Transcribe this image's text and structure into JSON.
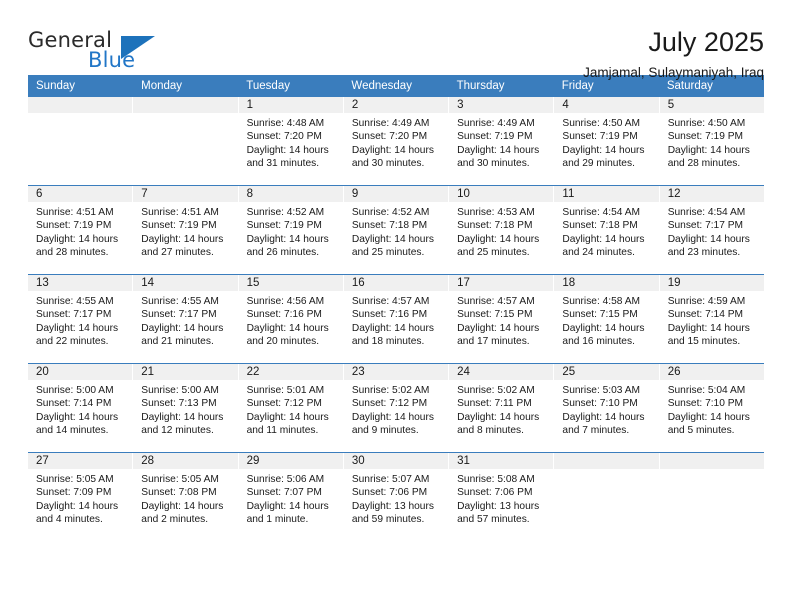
{
  "brand": {
    "name_part1": "General",
    "name_part2": "Blue",
    "triangle_icon": "brand-triangle-icon",
    "accent_color": "#1d72bb"
  },
  "header": {
    "title": "July 2025",
    "subtitle": "Jamjamal, Sulaymaniyah, Iraq"
  },
  "colors": {
    "header_blue": "#3a7dbd",
    "daynum_band": "#f0f0f0",
    "text": "#1a1a1a"
  },
  "calendar": {
    "day_headers": [
      "Sunday",
      "Monday",
      "Tuesday",
      "Wednesday",
      "Thursday",
      "Friday",
      "Saturday"
    ],
    "weeks": [
      [
        {
          "day": "",
          "sunrise": "",
          "sunset": "",
          "daylight_line1": "",
          "daylight_line2": ""
        },
        {
          "day": "",
          "sunrise": "",
          "sunset": "",
          "daylight_line1": "",
          "daylight_line2": ""
        },
        {
          "day": "1",
          "sunrise": "Sunrise: 4:48 AM",
          "sunset": "Sunset: 7:20 PM",
          "daylight_line1": "Daylight: 14 hours",
          "daylight_line2": "and 31 minutes."
        },
        {
          "day": "2",
          "sunrise": "Sunrise: 4:49 AM",
          "sunset": "Sunset: 7:20 PM",
          "daylight_line1": "Daylight: 14 hours",
          "daylight_line2": "and 30 minutes."
        },
        {
          "day": "3",
          "sunrise": "Sunrise: 4:49 AM",
          "sunset": "Sunset: 7:19 PM",
          "daylight_line1": "Daylight: 14 hours",
          "daylight_line2": "and 30 minutes."
        },
        {
          "day": "4",
          "sunrise": "Sunrise: 4:50 AM",
          "sunset": "Sunset: 7:19 PM",
          "daylight_line1": "Daylight: 14 hours",
          "daylight_line2": "and 29 minutes."
        },
        {
          "day": "5",
          "sunrise": "Sunrise: 4:50 AM",
          "sunset": "Sunset: 7:19 PM",
          "daylight_line1": "Daylight: 14 hours",
          "daylight_line2": "and 28 minutes."
        }
      ],
      [
        {
          "day": "6",
          "sunrise": "Sunrise: 4:51 AM",
          "sunset": "Sunset: 7:19 PM",
          "daylight_line1": "Daylight: 14 hours",
          "daylight_line2": "and 28 minutes."
        },
        {
          "day": "7",
          "sunrise": "Sunrise: 4:51 AM",
          "sunset": "Sunset: 7:19 PM",
          "daylight_line1": "Daylight: 14 hours",
          "daylight_line2": "and 27 minutes."
        },
        {
          "day": "8",
          "sunrise": "Sunrise: 4:52 AM",
          "sunset": "Sunset: 7:19 PM",
          "daylight_line1": "Daylight: 14 hours",
          "daylight_line2": "and 26 minutes."
        },
        {
          "day": "9",
          "sunrise": "Sunrise: 4:52 AM",
          "sunset": "Sunset: 7:18 PM",
          "daylight_line1": "Daylight: 14 hours",
          "daylight_line2": "and 25 minutes."
        },
        {
          "day": "10",
          "sunrise": "Sunrise: 4:53 AM",
          "sunset": "Sunset: 7:18 PM",
          "daylight_line1": "Daylight: 14 hours",
          "daylight_line2": "and 25 minutes."
        },
        {
          "day": "11",
          "sunrise": "Sunrise: 4:54 AM",
          "sunset": "Sunset: 7:18 PM",
          "daylight_line1": "Daylight: 14 hours",
          "daylight_line2": "and 24 minutes."
        },
        {
          "day": "12",
          "sunrise": "Sunrise: 4:54 AM",
          "sunset": "Sunset: 7:17 PM",
          "daylight_line1": "Daylight: 14 hours",
          "daylight_line2": "and 23 minutes."
        }
      ],
      [
        {
          "day": "13",
          "sunrise": "Sunrise: 4:55 AM",
          "sunset": "Sunset: 7:17 PM",
          "daylight_line1": "Daylight: 14 hours",
          "daylight_line2": "and 22 minutes."
        },
        {
          "day": "14",
          "sunrise": "Sunrise: 4:55 AM",
          "sunset": "Sunset: 7:17 PM",
          "daylight_line1": "Daylight: 14 hours",
          "daylight_line2": "and 21 minutes."
        },
        {
          "day": "15",
          "sunrise": "Sunrise: 4:56 AM",
          "sunset": "Sunset: 7:16 PM",
          "daylight_line1": "Daylight: 14 hours",
          "daylight_line2": "and 20 minutes."
        },
        {
          "day": "16",
          "sunrise": "Sunrise: 4:57 AM",
          "sunset": "Sunset: 7:16 PM",
          "daylight_line1": "Daylight: 14 hours",
          "daylight_line2": "and 18 minutes."
        },
        {
          "day": "17",
          "sunrise": "Sunrise: 4:57 AM",
          "sunset": "Sunset: 7:15 PM",
          "daylight_line1": "Daylight: 14 hours",
          "daylight_line2": "and 17 minutes."
        },
        {
          "day": "18",
          "sunrise": "Sunrise: 4:58 AM",
          "sunset": "Sunset: 7:15 PM",
          "daylight_line1": "Daylight: 14 hours",
          "daylight_line2": "and 16 minutes."
        },
        {
          "day": "19",
          "sunrise": "Sunrise: 4:59 AM",
          "sunset": "Sunset: 7:14 PM",
          "daylight_line1": "Daylight: 14 hours",
          "daylight_line2": "and 15 minutes."
        }
      ],
      [
        {
          "day": "20",
          "sunrise": "Sunrise: 5:00 AM",
          "sunset": "Sunset: 7:14 PM",
          "daylight_line1": "Daylight: 14 hours",
          "daylight_line2": "and 14 minutes."
        },
        {
          "day": "21",
          "sunrise": "Sunrise: 5:00 AM",
          "sunset": "Sunset: 7:13 PM",
          "daylight_line1": "Daylight: 14 hours",
          "daylight_line2": "and 12 minutes."
        },
        {
          "day": "22",
          "sunrise": "Sunrise: 5:01 AM",
          "sunset": "Sunset: 7:12 PM",
          "daylight_line1": "Daylight: 14 hours",
          "daylight_line2": "and 11 minutes."
        },
        {
          "day": "23",
          "sunrise": "Sunrise: 5:02 AM",
          "sunset": "Sunset: 7:12 PM",
          "daylight_line1": "Daylight: 14 hours",
          "daylight_line2": "and 9 minutes."
        },
        {
          "day": "24",
          "sunrise": "Sunrise: 5:02 AM",
          "sunset": "Sunset: 7:11 PM",
          "daylight_line1": "Daylight: 14 hours",
          "daylight_line2": "and 8 minutes."
        },
        {
          "day": "25",
          "sunrise": "Sunrise: 5:03 AM",
          "sunset": "Sunset: 7:10 PM",
          "daylight_line1": "Daylight: 14 hours",
          "daylight_line2": "and 7 minutes."
        },
        {
          "day": "26",
          "sunrise": "Sunrise: 5:04 AM",
          "sunset": "Sunset: 7:10 PM",
          "daylight_line1": "Daylight: 14 hours",
          "daylight_line2": "and 5 minutes."
        }
      ],
      [
        {
          "day": "27",
          "sunrise": "Sunrise: 5:05 AM",
          "sunset": "Sunset: 7:09 PM",
          "daylight_line1": "Daylight: 14 hours",
          "daylight_line2": "and 4 minutes."
        },
        {
          "day": "28",
          "sunrise": "Sunrise: 5:05 AM",
          "sunset": "Sunset: 7:08 PM",
          "daylight_line1": "Daylight: 14 hours",
          "daylight_line2": "and 2 minutes."
        },
        {
          "day": "29",
          "sunrise": "Sunrise: 5:06 AM",
          "sunset": "Sunset: 7:07 PM",
          "daylight_line1": "Daylight: 14 hours",
          "daylight_line2": "and 1 minute."
        },
        {
          "day": "30",
          "sunrise": "Sunrise: 5:07 AM",
          "sunset": "Sunset: 7:06 PM",
          "daylight_line1": "Daylight: 13 hours",
          "daylight_line2": "and 59 minutes."
        },
        {
          "day": "31",
          "sunrise": "Sunrise: 5:08 AM",
          "sunset": "Sunset: 7:06 PM",
          "daylight_line1": "Daylight: 13 hours",
          "daylight_line2": "and 57 minutes."
        },
        {
          "day": "",
          "sunrise": "",
          "sunset": "",
          "daylight_line1": "",
          "daylight_line2": ""
        },
        {
          "day": "",
          "sunrise": "",
          "sunset": "",
          "daylight_line1": "",
          "daylight_line2": ""
        }
      ]
    ]
  }
}
